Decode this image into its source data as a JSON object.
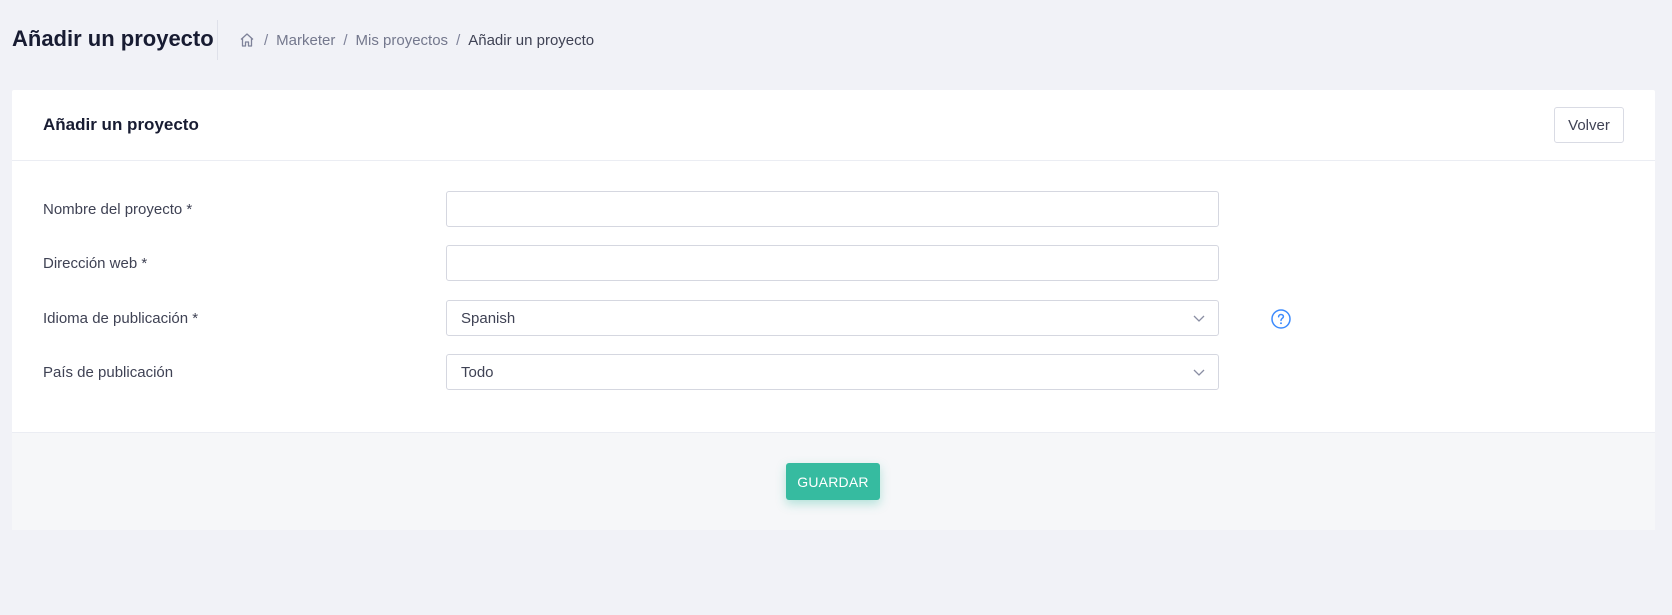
{
  "header": {
    "title": "Añadir un proyecto",
    "breadcrumb": {
      "home_icon": "home-icon",
      "separator": "/",
      "items": [
        "Marketer",
        "Mis proyectos",
        "Añadir un proyecto"
      ]
    }
  },
  "card": {
    "title": "Añadir un proyecto",
    "back_label": "Volver",
    "fields": {
      "project_name": {
        "label": "Nombre del proyecto *",
        "value": ""
      },
      "website": {
        "label": "Dirección web *",
        "value": ""
      },
      "language": {
        "label": "Idioma de publicación *",
        "value": "Spanish",
        "help_icon": "question-circle-icon"
      },
      "country": {
        "label": "País de publicación",
        "value": "Todo"
      }
    },
    "save_label": "GUARDAR"
  },
  "colors": {
    "accent": "#36bba0",
    "help": "#3d8bfd",
    "background": "#f1f2f7"
  }
}
